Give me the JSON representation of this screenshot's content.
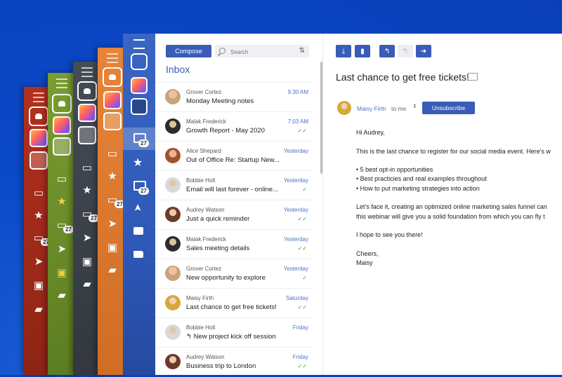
{
  "colors": {
    "accent": "#3a5cb8",
    "link": "#4a74c8",
    "page_bg": "#0b49c8"
  },
  "themes": [
    {
      "name": "red",
      "color": "#a52a1c",
      "badge": "27"
    },
    {
      "name": "green",
      "color": "#6c8f2a",
      "badge": "27"
    },
    {
      "name": "slate",
      "color": "#3f4650",
      "badge": "27"
    },
    {
      "name": "orange",
      "color": "#e07a2a",
      "badge": "27"
    }
  ],
  "sidebar": {
    "icons": [
      "menu-icon",
      "contacts-icon",
      "avatar-color",
      "avatar-dark",
      "folder-icon",
      "star-icon",
      "inbox-icon",
      "send-icon",
      "archive-icon",
      "folder-open-icon"
    ],
    "inbox_badge": "27",
    "folder_badge": "27"
  },
  "inbox": {
    "compose_label": "Compose",
    "search_placeholder": "Search",
    "title": "Inbox",
    "messages": [
      {
        "sender": "Grover Cortez",
        "subject": "Monday Meeting notes",
        "time": "9:30 AM",
        "check": ""
      },
      {
        "sender": "Malak Frederick",
        "subject": "Growth Report - May 2020",
        "time": "7:03 AM",
        "check": "✓✓"
      },
      {
        "sender": "Alice Shepard",
        "subject": "Out of Office Re: Startup New...",
        "time": "Yesterday",
        "check": ""
      },
      {
        "sender": "Bobbie Holt",
        "subject": "Email will last forever - online...",
        "time": "Yesterday",
        "check": "✓"
      },
      {
        "sender": "Audrey Watson",
        "subject": "Just a quick reminder",
        "time": "Yesterday",
        "check": "✓✓"
      },
      {
        "sender": "Malak Frederick",
        "subject": "Sales meeting details",
        "time": "Yesterday",
        "check": "✓✓"
      },
      {
        "sender": "Grover Cortez",
        "subject": "New opportunity to explore",
        "time": "Yesterday",
        "check": "✓"
      },
      {
        "sender": "Maisy Firth",
        "subject": "Last chance to get free tickets!",
        "time": "Saturday",
        "check": "✓✓"
      },
      {
        "sender": "Bobbie Holt",
        "subject": "↰ New project kick off session",
        "time": "Friday",
        "check": ""
      },
      {
        "sender": "Audrey Watson",
        "subject": "Business trip to London",
        "time": "Friday",
        "check": "✓✓"
      }
    ]
  },
  "reader": {
    "toolbar": [
      "download-icon",
      "delete-icon",
      "reply-icon",
      "reply-all-icon",
      "forward-icon"
    ],
    "subject": "Last chance to get free tickets!",
    "sender": "Maisy Firth",
    "to": "to me",
    "unsubscribe_label": "Unsubscribe",
    "greeting": "Hi Audrey,",
    "intro": "This is the last chance to register for our social media event. Here's w",
    "bullets": [
      "• 5 best opt-in opportunities",
      "• Best practicies and real examples throughout",
      "• How to put marketing strategies into action"
    ],
    "para1": "Let's face it, creating an optimized online marketing sales funnel can",
    "para2": "this webinar will give you a solid foundation from which you can fly t",
    "closing": "I hope to see you there!",
    "signoff": "Cheers,",
    "signature": "Maisy"
  }
}
